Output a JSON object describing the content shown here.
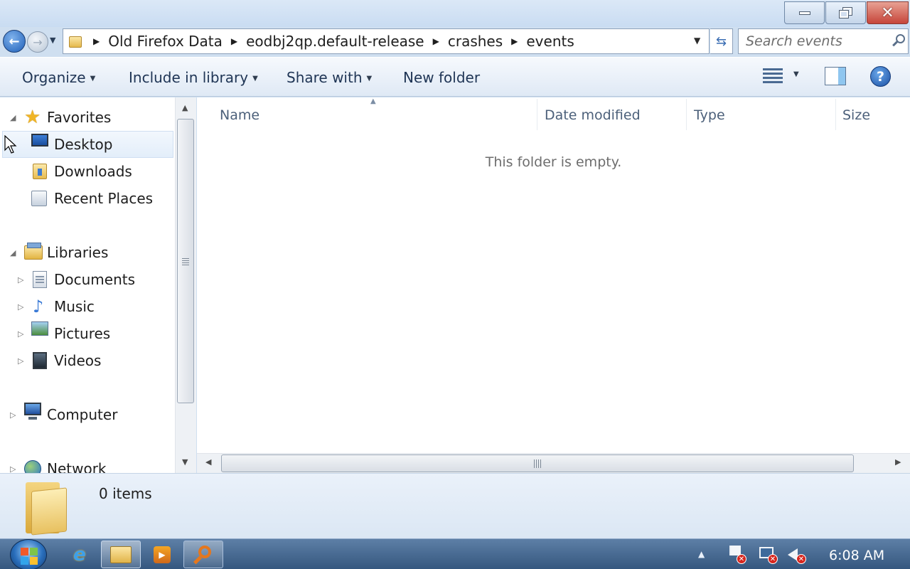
{
  "window": {
    "minimize_icon": "minimize-icon",
    "maximize_icon": "restore-icon",
    "close_icon": "close-icon"
  },
  "address": {
    "breadcrumbs": [
      "Old Firefox Data",
      "eodbj2qp.default-release",
      "crashes",
      "events"
    ],
    "search_placeholder": "Search events"
  },
  "toolbar": {
    "organize": "Organize",
    "include_in_library": "Include in library",
    "share_with": "Share with",
    "new_folder": "New folder"
  },
  "nav": {
    "favorites": "Favorites",
    "desktop": "Desktop",
    "downloads": "Downloads",
    "recent_places": "Recent Places",
    "libraries": "Libraries",
    "documents": "Documents",
    "music": "Music",
    "pictures": "Pictures",
    "videos": "Videos",
    "computer": "Computer",
    "network": "Network"
  },
  "columns": {
    "name": "Name",
    "date_modified": "Date modified",
    "type": "Type",
    "size": "Size"
  },
  "content": {
    "empty_message": "This folder is empty."
  },
  "details": {
    "item_count": "0 items"
  },
  "taskbar": {
    "clock": "6:08 AM"
  },
  "colors": {
    "accent": "#3a6db3",
    "toolbar_text": "#1f3555",
    "taskbar": "#35577f"
  }
}
